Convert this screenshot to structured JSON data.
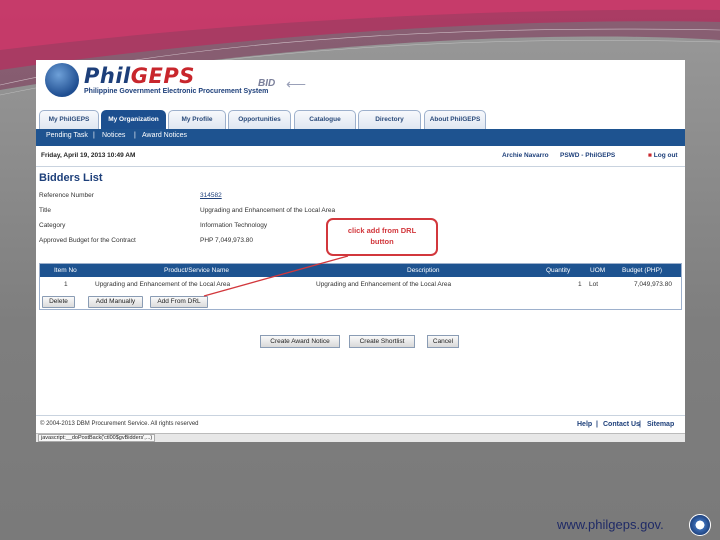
{
  "brand": {
    "logo_text_prefix": "Phil",
    "logo_text_suffix": "GEPS",
    "logo_subtitle": "Philippine Government Electronic Procurement System",
    "bid_label": "BID"
  },
  "tabs": [
    {
      "label": "My PhilGEPS"
    },
    {
      "label": "My Organization"
    },
    {
      "label": "My Profile"
    },
    {
      "label": "Opportunities"
    },
    {
      "label": "Catalogue"
    },
    {
      "label": "Directory"
    },
    {
      "label": "About PhilGEPS"
    }
  ],
  "subnav": [
    {
      "label": "Pending Task"
    },
    {
      "label": "|"
    },
    {
      "label": "Notices"
    },
    {
      "label": "|"
    },
    {
      "label": "Award Notices"
    }
  ],
  "status": {
    "date": "Friday, April 19, 2013 10:49 AM",
    "user": "Archie Navarro",
    "org": "PSWD - PhilGEPS",
    "logout": "Log out",
    "logout_bullet": "■"
  },
  "page": {
    "title": "Bidders List"
  },
  "info": [
    {
      "label": "Reference Number",
      "value": "314582"
    },
    {
      "label": "Title",
      "value": "Upgrading and Enhancement of the Local Area"
    },
    {
      "label": "Category",
      "value": "Information Technology"
    },
    {
      "label": "Approved Budget for the Contract",
      "value": "PHP 7,049,973.80"
    }
  ],
  "callout": {
    "line1": "click add from DRL",
    "line2": "button"
  },
  "table": {
    "headers": [
      "Item No",
      "Product/Service Name",
      "Description",
      "Quantity",
      "UOM",
      "Budget (PHP)"
    ],
    "rows": [
      [
        "1",
        "Upgrading and Enhancement of the Local Area",
        "Upgrading and Enhancement of the Local Area",
        "1",
        "Lot",
        "7,049,973.80"
      ]
    ],
    "row_buttons": [
      "Delete",
      "Add Manually",
      "Add From DRL"
    ]
  },
  "actions": [
    "Create Award Notice",
    "Create Shortlist",
    "Cancel"
  ],
  "footer": {
    "copyright": "© 2004-2013 DBM Procurement Service. All rights reserved",
    "links": [
      "Help",
      "|",
      "Contact Us",
      "|",
      "Sitemap"
    ]
  },
  "statusbar": {
    "url": "javascript:__doPostBack('ctl00$gvBidders',...)"
  },
  "slide": {
    "url": "www.philgeps.gov."
  }
}
